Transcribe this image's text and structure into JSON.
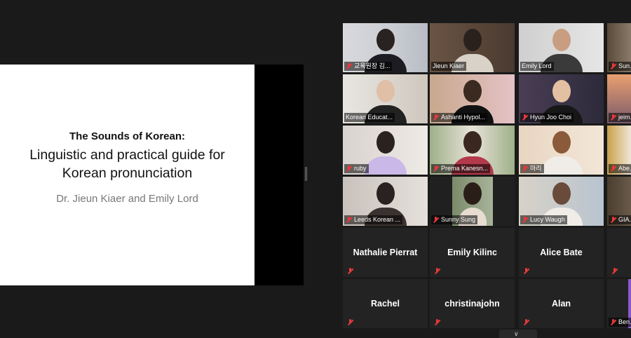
{
  "slide": {
    "title": "The Sounds of Korean:",
    "subtitle_line1": "Linguistic and practical guide for",
    "subtitle_line2": "Korean pronunciation",
    "authors": "Dr. Jieun Kiaer and Emily Lord"
  },
  "participants": [
    {
      "name": "교육원장 김..."
    },
    {
      "name": "Jieun Kiaer"
    },
    {
      "name": "Emily Lord"
    },
    {
      "name": "Sun..."
    },
    {
      "name": "Korean Educat..."
    },
    {
      "name": "Ashanti Hypol..."
    },
    {
      "name": "Hyun Joo Choi"
    },
    {
      "name": "jeim..."
    },
    {
      "name": "ruby"
    },
    {
      "name": "Prema Kanesn..."
    },
    {
      "name": "마리"
    },
    {
      "name": "Abe..."
    },
    {
      "name": "Leeds Korean ..."
    },
    {
      "name": "Sunny Sung"
    },
    {
      "name": "Lucy Waugh"
    },
    {
      "name": "GIA..."
    },
    {
      "name": "Nathalie Pierrat"
    },
    {
      "name": "Emily Kilinc"
    },
    {
      "name": "Alice Bate"
    },
    {
      "name": ""
    },
    {
      "name": "Rachel"
    },
    {
      "name": "christinajohn"
    },
    {
      "name": "Alan"
    },
    {
      "name": "Ben..."
    }
  ],
  "icons": {
    "mute": "muted-microphone-icon",
    "chevron": "chevron-down-icon"
  },
  "colors": {
    "active_speaker": "#c8e34a",
    "mute": "#e8393a"
  }
}
